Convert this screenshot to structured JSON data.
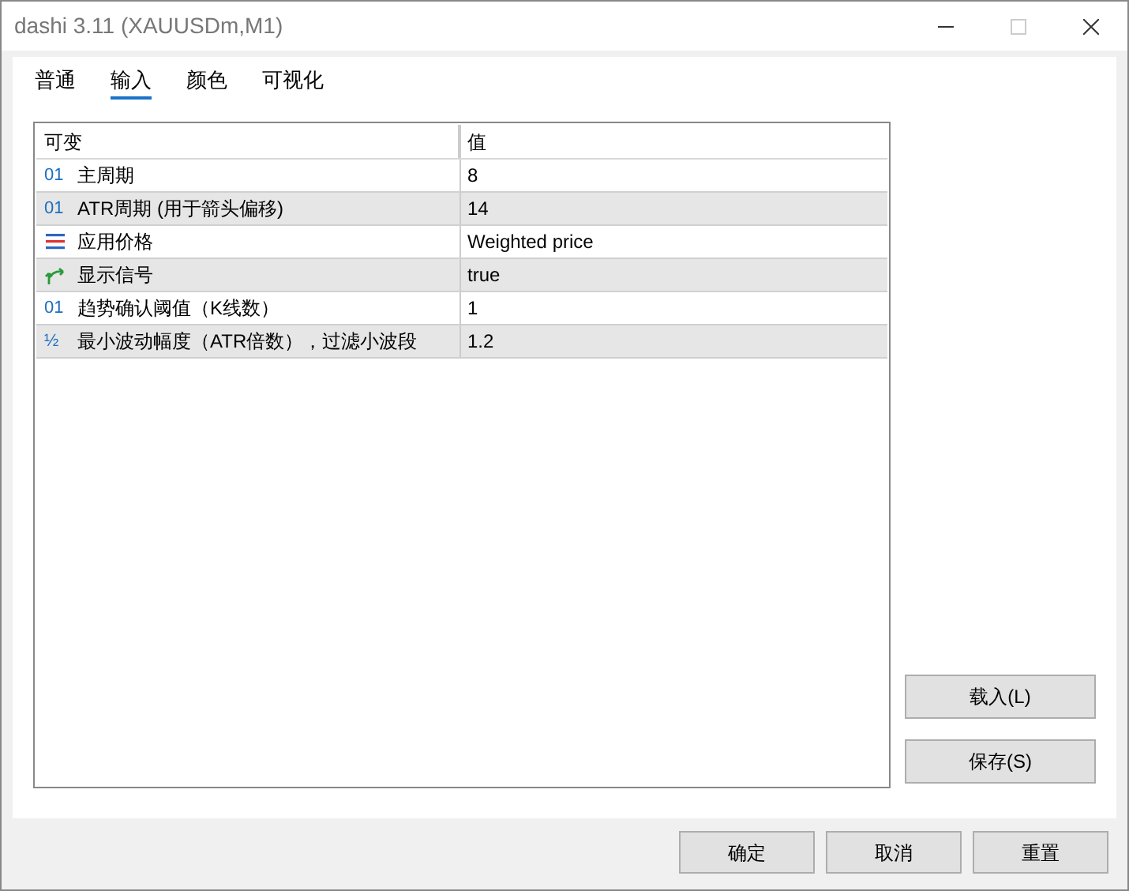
{
  "window": {
    "title": "dashi 3.11 (XAUUSDm,M1)"
  },
  "tabs": [
    {
      "label": "普通",
      "selected": false
    },
    {
      "label": "输入",
      "selected": true
    },
    {
      "label": "颜色",
      "selected": false
    },
    {
      "label": "可视化",
      "selected": false
    }
  ],
  "table": {
    "columns": [
      "可变",
      "值"
    ],
    "rows": [
      {
        "kind": "int",
        "mark": "01",
        "name": "主周期",
        "value": "8"
      },
      {
        "kind": "int",
        "mark": "01",
        "name": "ATR周期 (用于箭头偏移)",
        "value": "14"
      },
      {
        "kind": "enum",
        "name": "应用价格",
        "value": "Weighted price"
      },
      {
        "kind": "bool",
        "name": "显示信号",
        "value": "true"
      },
      {
        "kind": "int",
        "mark": "01",
        "name": "趋势确认阈值（K线数）",
        "value": "1"
      },
      {
        "kind": "double",
        "mark": "½",
        "name": "最小波动幅度（ATR倍数），过滤小波段",
        "value": "1.2"
      }
    ]
  },
  "side_buttons": [
    "载入(L)",
    "保存(S)"
  ],
  "buttons": [
    "确定",
    "取消",
    "重置"
  ]
}
